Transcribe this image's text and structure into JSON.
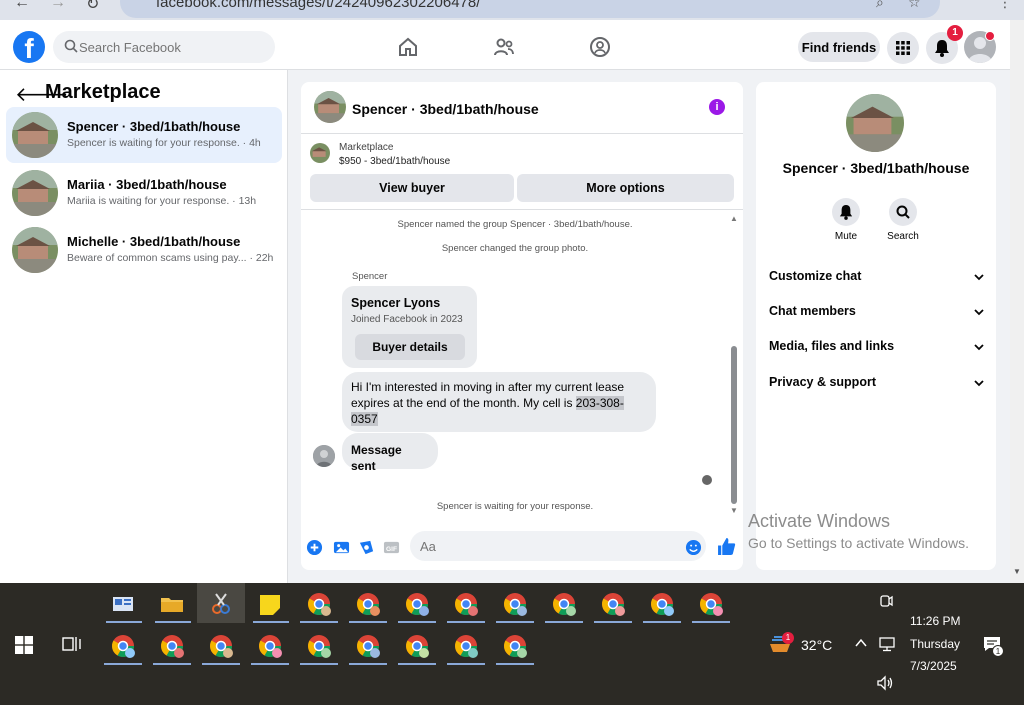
{
  "browser": {
    "url": "facebook.com/messages/t/24240962302206478/"
  },
  "header": {
    "search_placeholder": "Search Facebook",
    "find_friends_label": "Find friends",
    "notification_count": "1"
  },
  "sidebar": {
    "title": "Marketplace",
    "conversations": [
      {
        "name": "Spencer · 3bed/1bath/house",
        "preview": "Spencer is waiting for your response. · 4h"
      },
      {
        "name": "Mariia · 3bed/1bath/house",
        "preview": "Mariia is waiting for your response. · 13h"
      },
      {
        "name": "Michelle · 3bed/1bath/house",
        "preview": "Beware of common scams using pay... · 22h"
      }
    ]
  },
  "chat": {
    "title": "Spencer · 3bed/1bath/house",
    "listing": {
      "label": "Marketplace",
      "price_title": "$950 - 3bed/1bath/house"
    },
    "view_buyer_label": "View buyer",
    "more_options_label": "More options",
    "system_messages": [
      "Spencer named the group Spencer · 3bed/1bath/house.",
      "Spencer changed the group photo."
    ],
    "sender_label": "Spencer",
    "buyer_card": {
      "name": "Spencer Lyons",
      "joined": "Joined Facebook in 2023",
      "button_label": "Buyer details"
    },
    "message_text": "Hi I'm interested in moving in after my current lease expires at the end of the month. My cell is",
    "message_phone_part1": "203-308-",
    "message_phone_part2": "0357",
    "sent_message": "Message sent",
    "waiting_status": "Spencer is waiting for your response.",
    "composer_placeholder": "Aa"
  },
  "details": {
    "title": "Spencer · 3bed/1bath/house",
    "actions": [
      {
        "label": "Mute"
      },
      {
        "label": "Search"
      }
    ],
    "sections": [
      {
        "label": "Customize chat"
      },
      {
        "label": "Chat members"
      },
      {
        "label": "Media, files and links"
      },
      {
        "label": "Privacy & support"
      }
    ]
  },
  "watermark": {
    "line1": "Activate Windows",
    "line2": "Go to Settings to activate Windows."
  },
  "taskbar": {
    "weather_temp": "32°C",
    "time": "11:26 PM",
    "day": "Thursday",
    "date": "7/3/2025",
    "weather_badge": "1",
    "notification_badge": "1"
  },
  "colors": {
    "fb_blue": "#1877f2",
    "badge_red": "#e41e3f",
    "info_purple": "#9b18e7",
    "taskbar_bg": "#2c2a25"
  }
}
